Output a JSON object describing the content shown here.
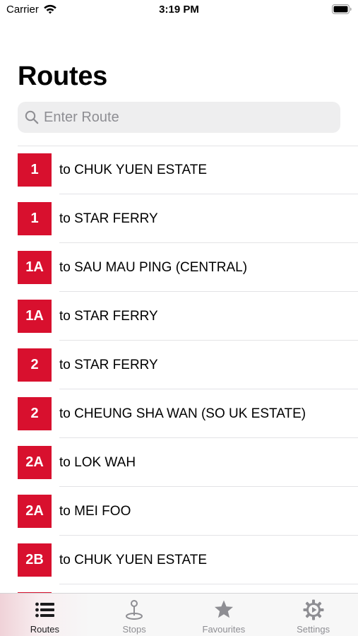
{
  "status_bar": {
    "carrier": "Carrier",
    "time": "3:19 PM"
  },
  "header": {
    "title": "Routes"
  },
  "search": {
    "placeholder": "Enter Route",
    "value": ""
  },
  "routes": [
    {
      "number": "1",
      "destination": "to CHUK YUEN ESTATE"
    },
    {
      "number": "1",
      "destination": "to STAR FERRY"
    },
    {
      "number": "1A",
      "destination": "to SAU MAU PING (CENTRAL)"
    },
    {
      "number": "1A",
      "destination": "to STAR FERRY"
    },
    {
      "number": "2",
      "destination": "to STAR FERRY"
    },
    {
      "number": "2",
      "destination": "to CHEUNG SHA WAN (SO UK ESTATE)"
    },
    {
      "number": "2A",
      "destination": "to LOK WAH"
    },
    {
      "number": "2A",
      "destination": "to MEI FOO"
    },
    {
      "number": "2B",
      "destination": "to CHUK YUEN ESTATE"
    },
    {
      "number": "",
      "destination": ""
    }
  ],
  "tab_bar": {
    "tabs": [
      {
        "label": "Routes",
        "icon": "list-icon",
        "active": true
      },
      {
        "label": "Stops",
        "icon": "bus-stop-icon",
        "active": false
      },
      {
        "label": "Favourites",
        "icon": "star-icon",
        "active": false
      },
      {
        "label": "Settings",
        "icon": "gear-icon",
        "active": false
      }
    ]
  },
  "colors": {
    "route_badge": "#d8102e",
    "active_tab": "#1c1c1e",
    "inactive_tab": "#8e8e93"
  }
}
